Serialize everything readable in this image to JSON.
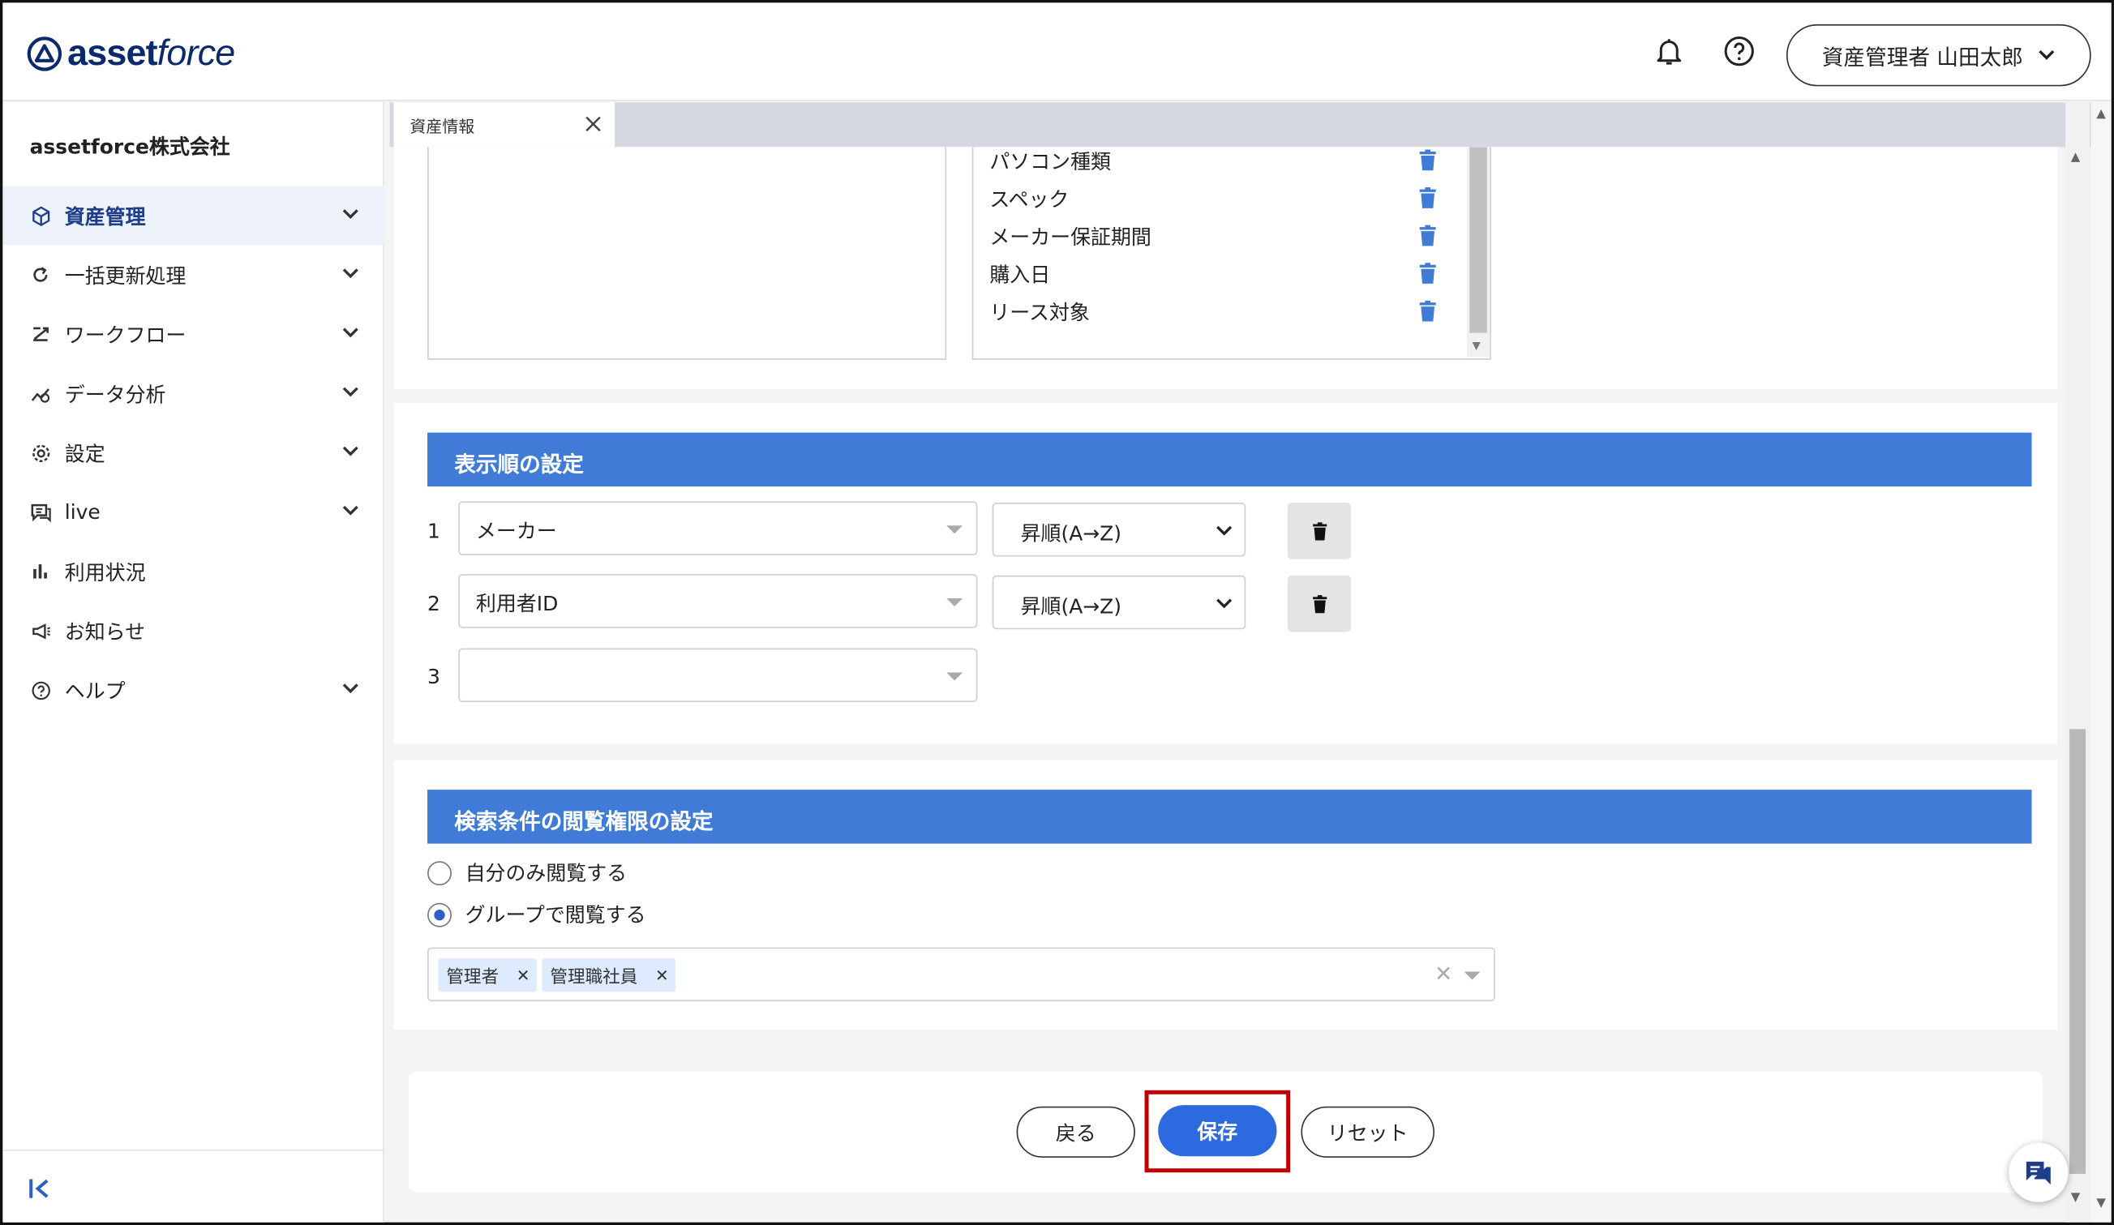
{
  "header": {
    "logo_main": "asset",
    "logo_sub": "force",
    "user_label": "資産管理者 山田太郎"
  },
  "sidebar": {
    "company": "assetforce株式会社",
    "items": [
      {
        "label": "資産管理",
        "icon": "cube-icon",
        "active": true,
        "expandable": true
      },
      {
        "label": "一括更新処理",
        "icon": "refresh-icon",
        "active": false,
        "expandable": true
      },
      {
        "label": "ワークフロー",
        "icon": "workflow-icon",
        "active": false,
        "expandable": true
      },
      {
        "label": "データ分析",
        "icon": "analytics-icon",
        "active": false,
        "expandable": true
      },
      {
        "label": "設定",
        "icon": "gear-icon",
        "active": false,
        "expandable": true
      },
      {
        "label": "live",
        "icon": "chat-icon",
        "active": false,
        "expandable": true
      },
      {
        "label": "利用状況",
        "icon": "bar-chart-icon",
        "active": false,
        "expandable": false
      },
      {
        "label": "お知らせ",
        "icon": "megaphone-icon",
        "active": false,
        "expandable": false
      },
      {
        "label": "ヘルプ",
        "icon": "help-circle-icon",
        "active": false,
        "expandable": true
      }
    ]
  },
  "tabs": [
    {
      "label": "資産情報"
    }
  ],
  "field_list": {
    "items": [
      "パソコン種類",
      "スペック",
      "メーカー保証期間",
      "購入日",
      "リース対象"
    ]
  },
  "sort_section": {
    "title": "表示順の設定",
    "rows": [
      {
        "num": "1",
        "field": "メーカー",
        "order": "昇順(A→Z)"
      },
      {
        "num": "2",
        "field": "利用者ID",
        "order": "昇順(A→Z)"
      },
      {
        "num": "3",
        "field": "",
        "order": ""
      }
    ]
  },
  "permission_section": {
    "title": "検索条件の閲覧権限の設定",
    "options": [
      {
        "label": "自分のみ閲覧する",
        "selected": false
      },
      {
        "label": "グループで閲覧する",
        "selected": true
      }
    ],
    "groups": [
      "管理者",
      "管理職社員"
    ]
  },
  "footer": {
    "back_label": "戻る",
    "save_label": "保存",
    "reset_label": "リセット"
  },
  "colors": {
    "accent": "#3f7bd7",
    "primary_button": "#2d6ae0",
    "highlight": "#c00000"
  }
}
